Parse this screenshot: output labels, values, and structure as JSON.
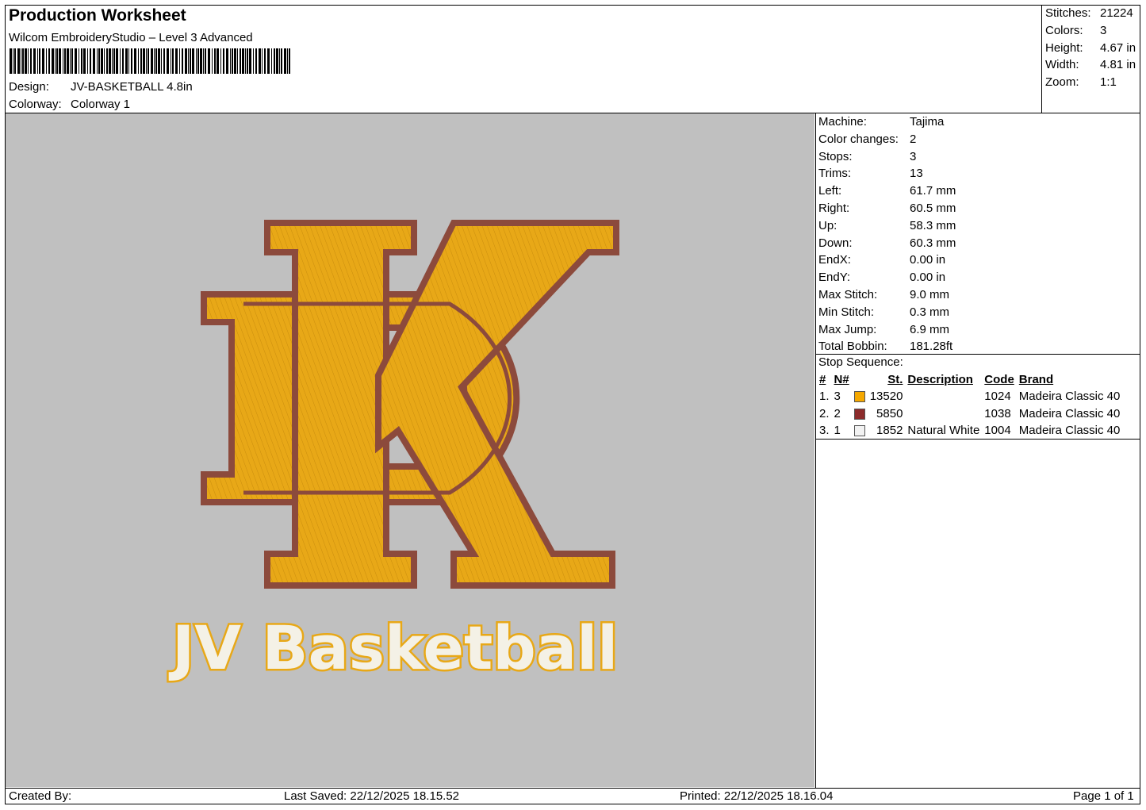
{
  "header": {
    "title": "Production Worksheet",
    "software": "Wilcom EmbroideryStudio – Level 3 Advanced",
    "design_label": "Design:",
    "design_value": "JV-BASKETBALL 4.8in",
    "colorway_label": "Colorway:",
    "colorway_value": "Colorway 1"
  },
  "stats": [
    {
      "label": "Stitches:",
      "value": "21224"
    },
    {
      "label": "Colors:",
      "value": "3"
    },
    {
      "label": "Height:",
      "value": "4.67 in"
    },
    {
      "label": "Width:",
      "value": "4.81 in"
    },
    {
      "label": "Zoom:",
      "value": "1:1"
    }
  ],
  "params": [
    {
      "label": "Machine:",
      "value": "Tajima"
    },
    {
      "label": "Color changes:",
      "value": "2"
    },
    {
      "label": "Stops:",
      "value": "3"
    },
    {
      "label": "Trims:",
      "value": "13"
    },
    {
      "label": "Left:",
      "value": "61.7 mm"
    },
    {
      "label": "Right:",
      "value": "60.5 mm"
    },
    {
      "label": "Up:",
      "value": "58.3 mm"
    },
    {
      "label": "Down:",
      "value": "60.3 mm"
    },
    {
      "label": "EndX:",
      "value": "0.00 in"
    },
    {
      "label": "EndY:",
      "value": "0.00 in"
    },
    {
      "label": "Max Stitch:",
      "value": "9.0 mm"
    },
    {
      "label": "Min Stitch:",
      "value": "0.3 mm"
    },
    {
      "label": "Max Jump:",
      "value": "6.9 mm"
    },
    {
      "label": "Total Bobbin:",
      "value": "181.28ft"
    }
  ],
  "stop_sequence": {
    "title": "Stop Sequence:",
    "headers": [
      "#",
      "N#",
      "St.",
      "Description",
      "Code",
      "Brand"
    ],
    "rows": [
      {
        "idx": "1.",
        "n": "3",
        "color": "#f5a800",
        "st": "13520",
        "desc": "",
        "code": "1024",
        "brand": "Madeira Classic 40"
      },
      {
        "idx": "2.",
        "n": "2",
        "color": "#8c2b2b",
        "st": "5850",
        "desc": "",
        "code": "1038",
        "brand": "Madeira Classic 40"
      },
      {
        "idx": "3.",
        "n": "1",
        "color": "#f2f2f2",
        "st": "1852",
        "desc": "Natural White",
        "code": "1004",
        "brand": "Madeira Classic 40"
      }
    ]
  },
  "design": {
    "text": "JV Basketball",
    "fill_gold": "#e8a817",
    "outline_maroon": "#8c4a3c",
    "text_white": "#f4f1e6",
    "canvas_bg": "#c0c0c0"
  },
  "footer": {
    "created_by": "Created By:",
    "last_saved": "Last Saved: 22/12/2025 18.15.52",
    "printed": "Printed: 22/12/2025 18.16.04",
    "page": "Page 1 of 1"
  }
}
